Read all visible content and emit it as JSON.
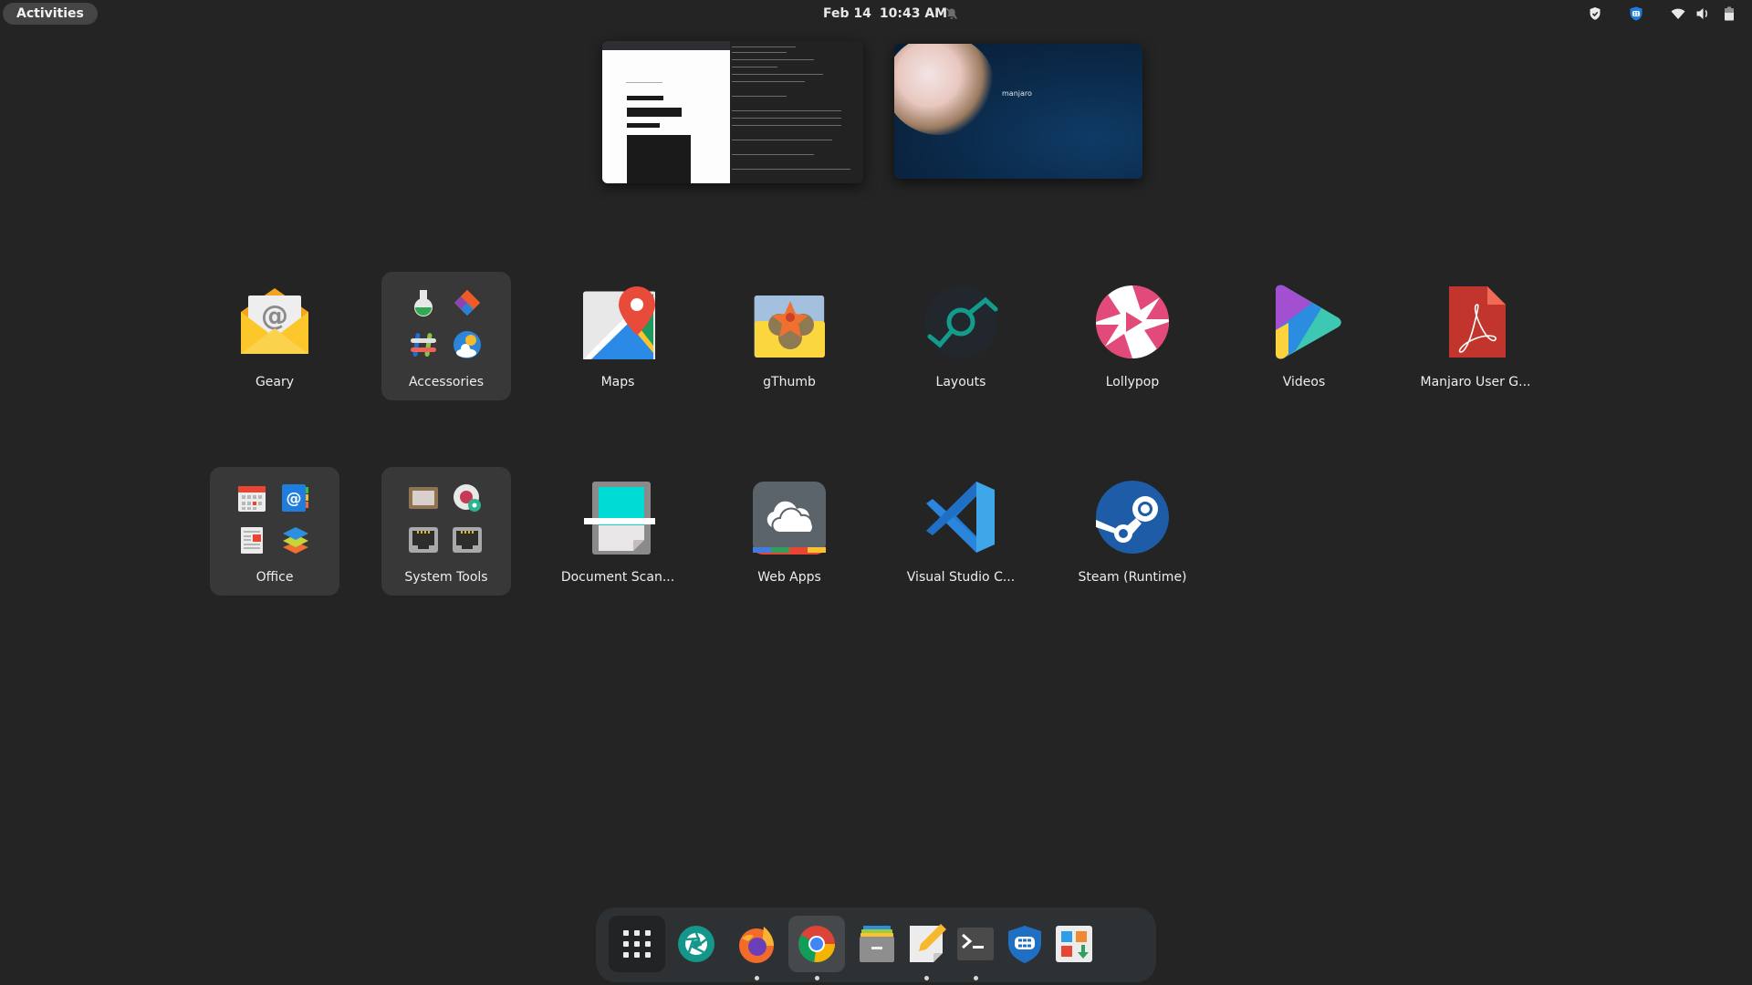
{
  "topbar": {
    "activities_label": "Activities",
    "date": "Feb 14",
    "time": "10:43 AM",
    "notifications_icon": "bell-muted-icon",
    "tray_icons": [
      "shield-check-icon",
      "vpn-shield-icon",
      "wifi-icon",
      "volume-icon",
      "battery-icon"
    ]
  },
  "workspaces": [
    {
      "name": "workspace-1",
      "content": "Browser and terminal windows"
    },
    {
      "name": "workspace-2",
      "content": "Empty desktop",
      "wallpaper_text": "manjaro"
    }
  ],
  "app_grid": {
    "apps": [
      {
        "label": "Geary",
        "icon": "geary-mail-icon",
        "folder": false
      },
      {
        "label": "Accessories",
        "icon": "accessories-folder-icon",
        "folder": true
      },
      {
        "label": "Maps",
        "icon": "maps-icon",
        "folder": false
      },
      {
        "label": "gThumb",
        "icon": "gthumb-icon",
        "folder": false
      },
      {
        "label": "Layouts",
        "icon": "layouts-icon",
        "folder": false
      },
      {
        "label": "Lollypop",
        "icon": "lollypop-icon",
        "folder": false
      },
      {
        "label": "Videos",
        "icon": "videos-icon",
        "folder": false
      },
      {
        "label": "Manjaro User G...",
        "icon": "pdf-document-icon",
        "folder": false
      },
      {
        "label": "Office",
        "icon": "office-folder-icon",
        "folder": true
      },
      {
        "label": "System Tools",
        "icon": "system-tools-folder-icon",
        "folder": true
      },
      {
        "label": "Document Scan...",
        "icon": "document-scanner-icon",
        "folder": false
      },
      {
        "label": "Web Apps",
        "icon": "web-apps-icon",
        "folder": false
      },
      {
        "label": "Visual Studio C...",
        "icon": "vscode-icon",
        "folder": false
      },
      {
        "label": "Steam (Runtime)",
        "icon": "steam-icon",
        "folder": false
      }
    ]
  },
  "dock": {
    "items": [
      {
        "name": "show-apps",
        "icon": "app-grid-icon",
        "running": false
      },
      {
        "name": "aperture",
        "icon": "camera-aperture-icon",
        "running": false
      },
      {
        "name": "firefox",
        "icon": "firefox-icon",
        "running": true
      },
      {
        "name": "chrome",
        "icon": "chrome-icon",
        "running": true,
        "focused": true
      },
      {
        "name": "files",
        "icon": "file-cabinet-icon",
        "running": false
      },
      {
        "name": "text-editor",
        "icon": "text-editor-icon",
        "running": true
      },
      {
        "name": "terminal",
        "icon": "terminal-icon",
        "running": true
      },
      {
        "name": "vpn-client",
        "icon": "vpn-shield-icon",
        "running": false
      },
      {
        "name": "software",
        "icon": "software-install-icon",
        "running": false
      }
    ]
  }
}
